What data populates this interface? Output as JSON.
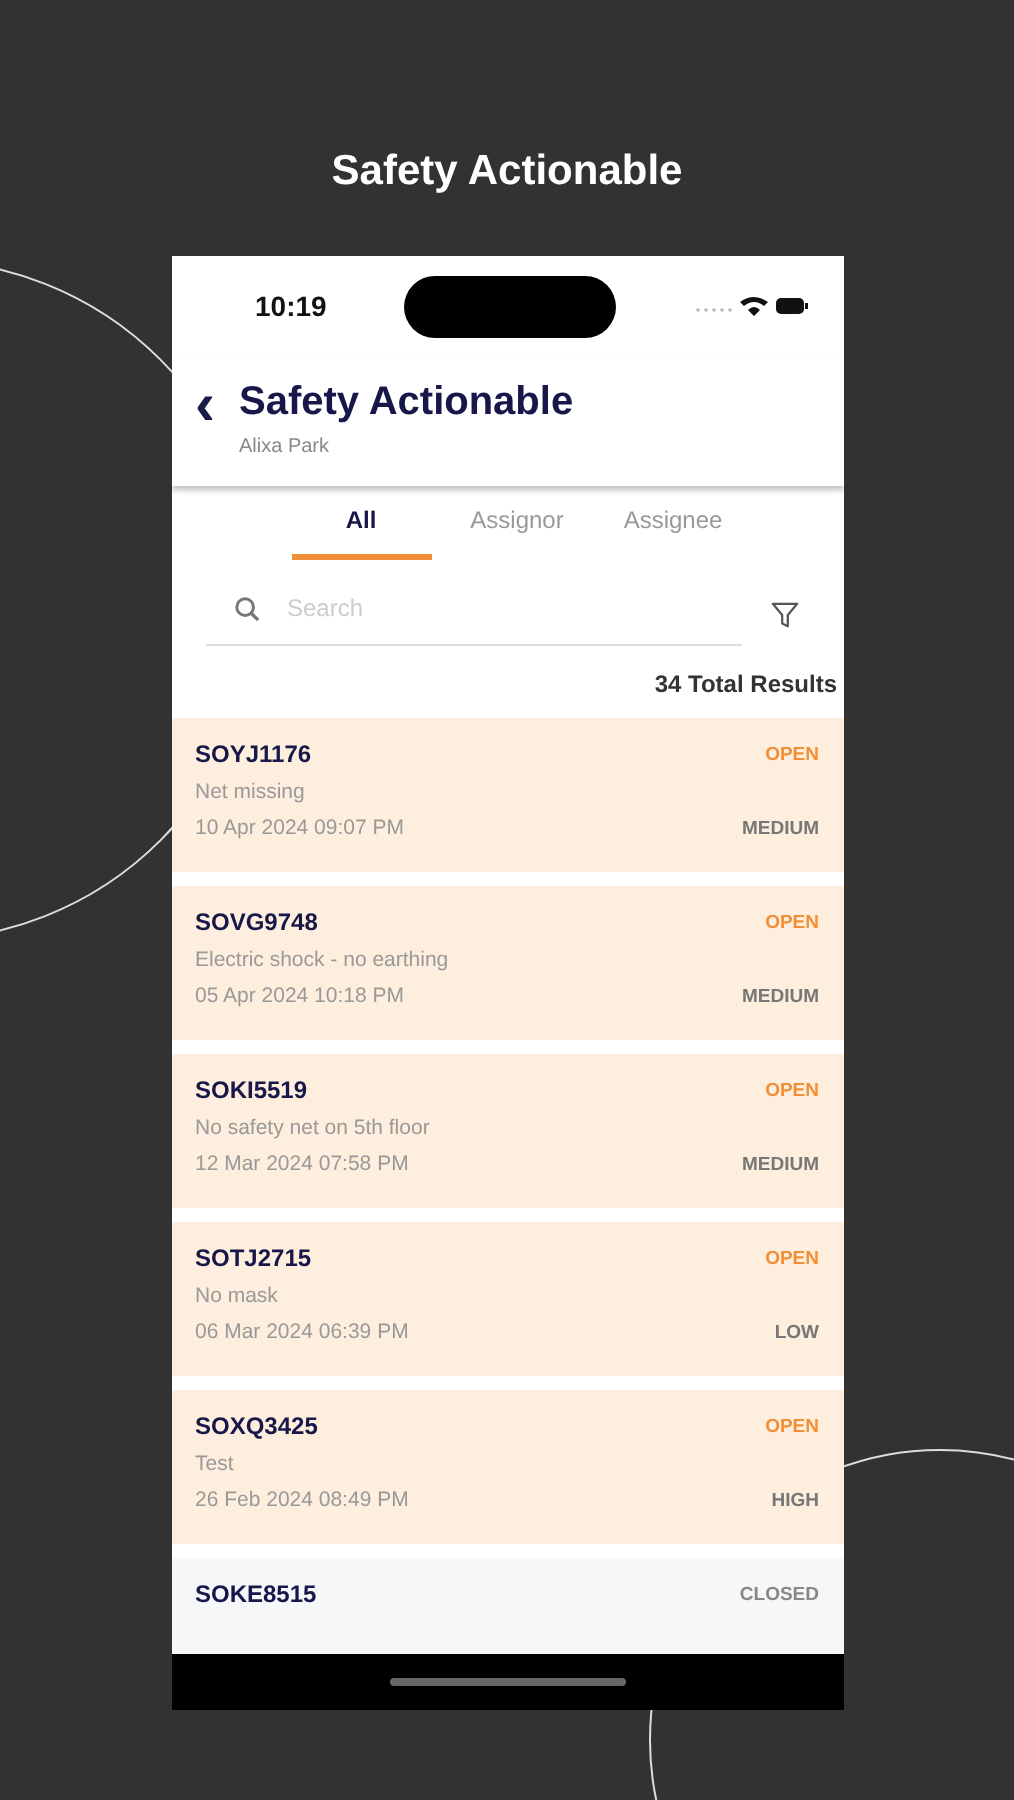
{
  "page_title": "Safety Actionable",
  "status_bar": {
    "time": "10:19"
  },
  "header": {
    "back": "‹",
    "title": "Safety Actionable",
    "subtitle": "Alixa Park"
  },
  "tabs": [
    {
      "label": "All",
      "selected": true
    },
    {
      "label": "Assignor",
      "selected": false
    },
    {
      "label": "Assignee",
      "selected": false
    }
  ],
  "search": {
    "placeholder": "Search"
  },
  "results": "34 Total Results",
  "items": [
    {
      "id": "SOYJ1176",
      "status": "OPEN",
      "open": true,
      "description": "Net missing",
      "date": "10 Apr 2024 09:07 PM",
      "priority": "MEDIUM"
    },
    {
      "id": "SOVG9748",
      "status": "OPEN",
      "open": true,
      "description": "Electric shock - no earthing",
      "date": "05 Apr 2024 10:18 PM",
      "priority": "MEDIUM"
    },
    {
      "id": "SOKI5519",
      "status": "OPEN",
      "open": true,
      "description": "No safety net on 5th floor",
      "date": "12 Mar 2024 07:58 PM",
      "priority": "MEDIUM"
    },
    {
      "id": "SOTJ2715",
      "status": "OPEN",
      "open": true,
      "description": "No mask",
      "date": "06 Mar 2024 06:39 PM",
      "priority": "LOW"
    },
    {
      "id": "SOXQ3425",
      "status": "OPEN",
      "open": true,
      "description": "Test",
      "date": "26 Feb 2024 08:49 PM",
      "priority": "HIGH"
    },
    {
      "id": "SOKE8515",
      "status": "CLOSED",
      "open": false
    }
  ]
}
